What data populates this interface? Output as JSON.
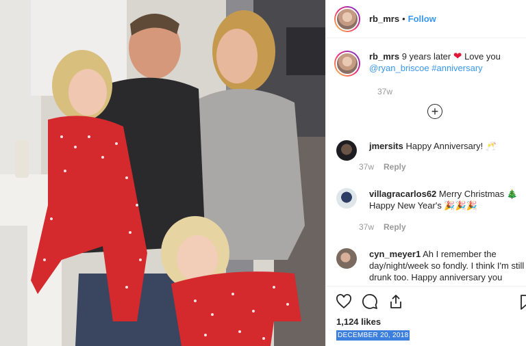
{
  "post": {
    "username": "rb_mrs",
    "follow_label": "Follow",
    "caption_text": "9 years later",
    "caption_love": "Love you",
    "caption_mention": "@ryan_briscoe",
    "caption_hashtag": "#anniversary",
    "caption_time": "37w",
    "heart_icon": "❤",
    "likes": "1,124 likes",
    "date": "DECEMBER 20, 2018"
  },
  "comments": [
    {
      "username": "jmersits",
      "text": "Happy Anniversary! 🥂",
      "time": "37w",
      "reply": "Reply"
    },
    {
      "username": "villagracarlos62",
      "text": "Merry Christmas 🎄 Happy New Year's 🎉🎉🎉",
      "time": "37w",
      "reply": "Reply"
    },
    {
      "username": "cyn_meyer1",
      "text": "Ah I remember the day/night/week so fondly. I think I'm still drunk too. Happy anniversary you"
    }
  ],
  "icons": {
    "load_more": "plus-circle-icon",
    "like": "heart-outline-icon",
    "comment": "comment-bubble-icon",
    "share": "share-icon",
    "save": "bookmark-icon"
  },
  "colors": {
    "link": "#3897f0",
    "heart": "#e0163b",
    "date_highlight": "#3d7fdc"
  }
}
